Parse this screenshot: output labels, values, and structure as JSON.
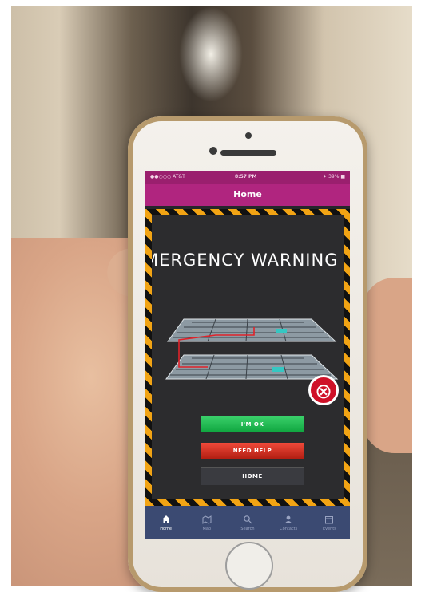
{
  "status_bar": {
    "carrier": "●●○○○ AT&T",
    "time": "8:57 PM",
    "battery": "✦ 39% ■"
  },
  "nav": {
    "title": "Home"
  },
  "alert": {
    "title": "MERGENCY WARNING",
    "close_icon": "close-circle-icon",
    "buttons": {
      "ok": "I'M OK",
      "help": "NEED HELP",
      "home": "HOME"
    }
  },
  "tabs": [
    {
      "label": "Home",
      "icon": "home-icon"
    },
    {
      "label": "Map",
      "icon": "map-icon"
    },
    {
      "label": "Search",
      "icon": "search-icon"
    },
    {
      "label": "Contacts",
      "icon": "contacts-icon"
    },
    {
      "label": "Events",
      "icon": "events-icon"
    }
  ],
  "colors": {
    "accent": "#b0257f",
    "hazard": "#f2a414",
    "ok": "#1fb84f",
    "help": "#d0321f",
    "close": "#cf1128",
    "tabbar": "#3b4a72"
  }
}
